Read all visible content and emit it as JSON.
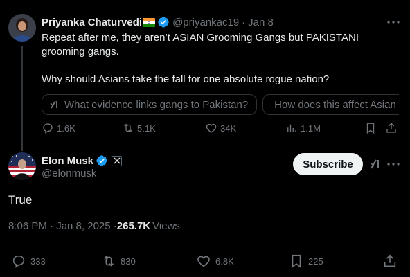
{
  "parent_tweet": {
    "author_name": "Priyanka Chaturvedi",
    "flag_icon": "india-flag-icon",
    "handle": "@priyankac19",
    "separator": "·",
    "date": "Jan 8",
    "text_line1": "Repeat after me, they aren’t ASIAN Grooming Gangs but PAKISTANI grooming gangs.",
    "text_line2": "Why should Asians take the fall for one absolute rogue nation?",
    "grok_suggestions": [
      "What evidence links gangs to Pakistan?",
      "How does this affect Asian"
    ],
    "actions": {
      "replies": "1.6K",
      "reposts": "5.1K",
      "likes": "34K",
      "views": "1.1M"
    }
  },
  "main_tweet": {
    "author_name": "Elon Musk",
    "handle": "@elonmusk",
    "subscribe_label": "Subscribe",
    "text": "True",
    "time": "8:06 PM · Jan 8, 2025 · ",
    "views_count": "265.7K",
    "views_label": "Views",
    "actions": {
      "replies": "333",
      "reposts": "830",
      "likes": "6.8K",
      "bookmarks": "225"
    }
  },
  "colors": {
    "background": "#000000",
    "text": "#e7e9ea",
    "muted": "#71767b",
    "verified": "#1d9bf0",
    "border": "#2f3336"
  }
}
